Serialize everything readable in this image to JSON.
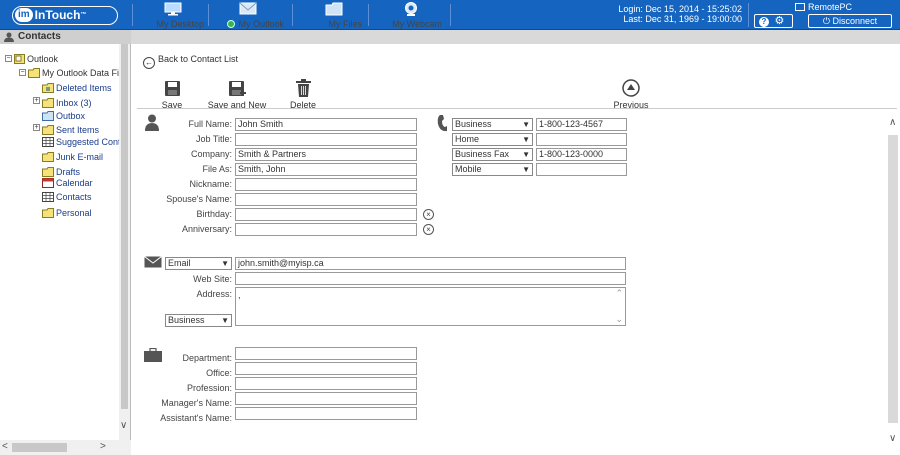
{
  "header": {
    "logo_im": "im",
    "logo_text": "InTouch",
    "nav": [
      {
        "label": "My Desktop"
      },
      {
        "label": "My Outlook"
      },
      {
        "label": "My Files"
      },
      {
        "label": "My Webcam"
      }
    ],
    "login": "Login: Dec 15, 2014 - 15:25:02",
    "last": "Last: Dec 31, 1969 - 19:00:00",
    "remote": "RemotePC",
    "help": "?",
    "disconnect": "Disconnect"
  },
  "sidebar": {
    "title": "Contacts",
    "tree": {
      "root": "Outlook",
      "data_file": "My Outlook Data Fi",
      "items": [
        {
          "label": "Deleted Items"
        },
        {
          "label": "Inbox (3)"
        },
        {
          "label": "Outbox"
        },
        {
          "label": "Sent Items"
        },
        {
          "label": "Suggested Cont"
        },
        {
          "label": "Junk E-mail"
        },
        {
          "label": "Drafts"
        },
        {
          "label": "Calendar"
        },
        {
          "label": "Contacts"
        },
        {
          "label": "Personal"
        }
      ]
    }
  },
  "main": {
    "back": "Back to Contact List",
    "toolbar": {
      "save": "Save",
      "save_new": "Save and New",
      "delete": "Delete",
      "previous": "Previous"
    },
    "name_section": {
      "full_name_label": "Full Name:",
      "full_name": "John Smith",
      "job_title_label": "Job Title:",
      "job_title": "",
      "company_label": "Company:",
      "company": "Smith & Partners",
      "file_as_label": "File As:",
      "file_as": "Smith, John",
      "nickname_label": "Nickname:",
      "nickname": "",
      "spouse_label": "Spouse's Name:",
      "spouse": "",
      "birthday_label": "Birthday:",
      "birthday": "",
      "anniversary_label": "Anniversary:",
      "anniversary": ""
    },
    "phones": [
      {
        "type": "Business",
        "value": "1-800-123-4567"
      },
      {
        "type": "Home",
        "value": ""
      },
      {
        "type": "Business Fax",
        "value": "1-800-123-0000"
      },
      {
        "type": "Mobile",
        "value": ""
      }
    ],
    "contact_section": {
      "email_type": "Email",
      "email": "john.smith@myisp.ca",
      "website_label": "Web Site:",
      "website": "",
      "address_label": "Address:",
      "address": ",",
      "address_type": "Business"
    },
    "work_section": {
      "department_label": "Department:",
      "department": "",
      "office_label": "Office:",
      "office": "",
      "profession_label": "Profession:",
      "profession": "",
      "manager_label": "Manager's Name:",
      "manager": "",
      "assistant_label": "Assistant's Name:",
      "assistant": ""
    }
  }
}
